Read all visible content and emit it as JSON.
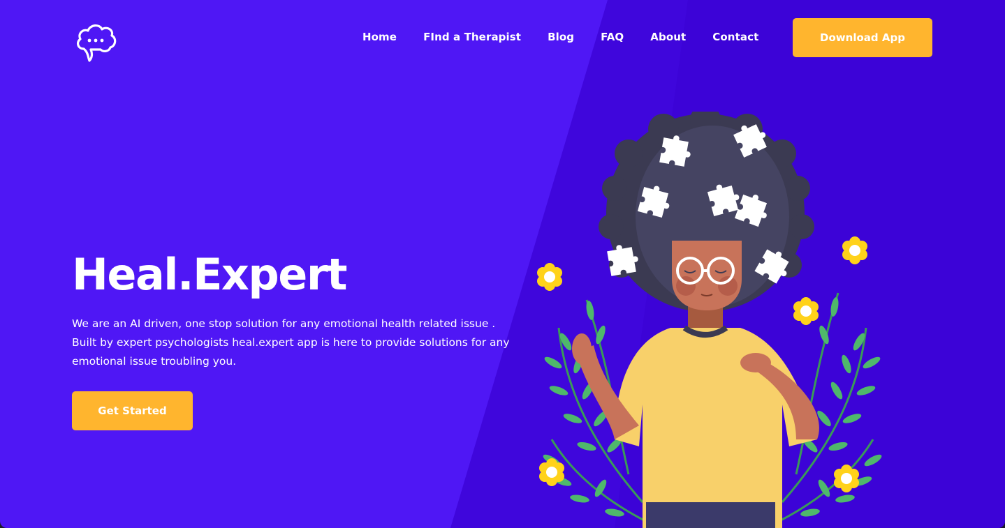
{
  "brand": {
    "logo_icon": "chat-cloud-icon"
  },
  "nav": {
    "items": [
      {
        "label": "Home"
      },
      {
        "label": "FInd a Therapist"
      },
      {
        "label": "Blog"
      },
      {
        "label": "FAQ"
      },
      {
        "label": "About"
      },
      {
        "label": "Contact"
      }
    ],
    "download_label": "Download App"
  },
  "hero": {
    "title": "Heal.Expert",
    "description": "We are an AI driven, one stop solution for any emotional health related issue . Built by expert psychologists heal.expert app is here to provide solutions for any emotional issue troubling you.",
    "cta_label": "Get Started"
  },
  "colors": {
    "background": "#4f17f5",
    "background_dark": "#3d05d8",
    "accent": "#ffb52e",
    "text": "#ffffff"
  }
}
